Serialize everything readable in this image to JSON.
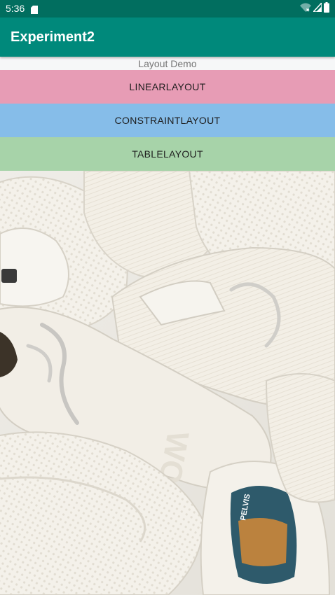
{
  "status_bar": {
    "time": "5:36",
    "icons": [
      "sd-card-icon",
      "wifi-icon",
      "signal-icon",
      "battery-icon"
    ]
  },
  "app_bar": {
    "title": "Experiment2",
    "color": "#00897b"
  },
  "main": {
    "subtitle": "Layout Demo",
    "buttons": [
      {
        "label": "LINEARLAYOUT",
        "color": "#e79cb5"
      },
      {
        "label": "CONSTRAINTLAYOUT",
        "color": "#86bde9"
      },
      {
        "label": "TABLELAYOUT",
        "color": "#a7d3a9"
      }
    ],
    "image": {
      "subject": "white sneakers photo",
      "embossed_text": "WORLD",
      "insole_text": "PELVIS"
    }
  },
  "colors": {
    "status_bar": "#016e5f",
    "subtitle_bg": "#f6f7f8"
  }
}
